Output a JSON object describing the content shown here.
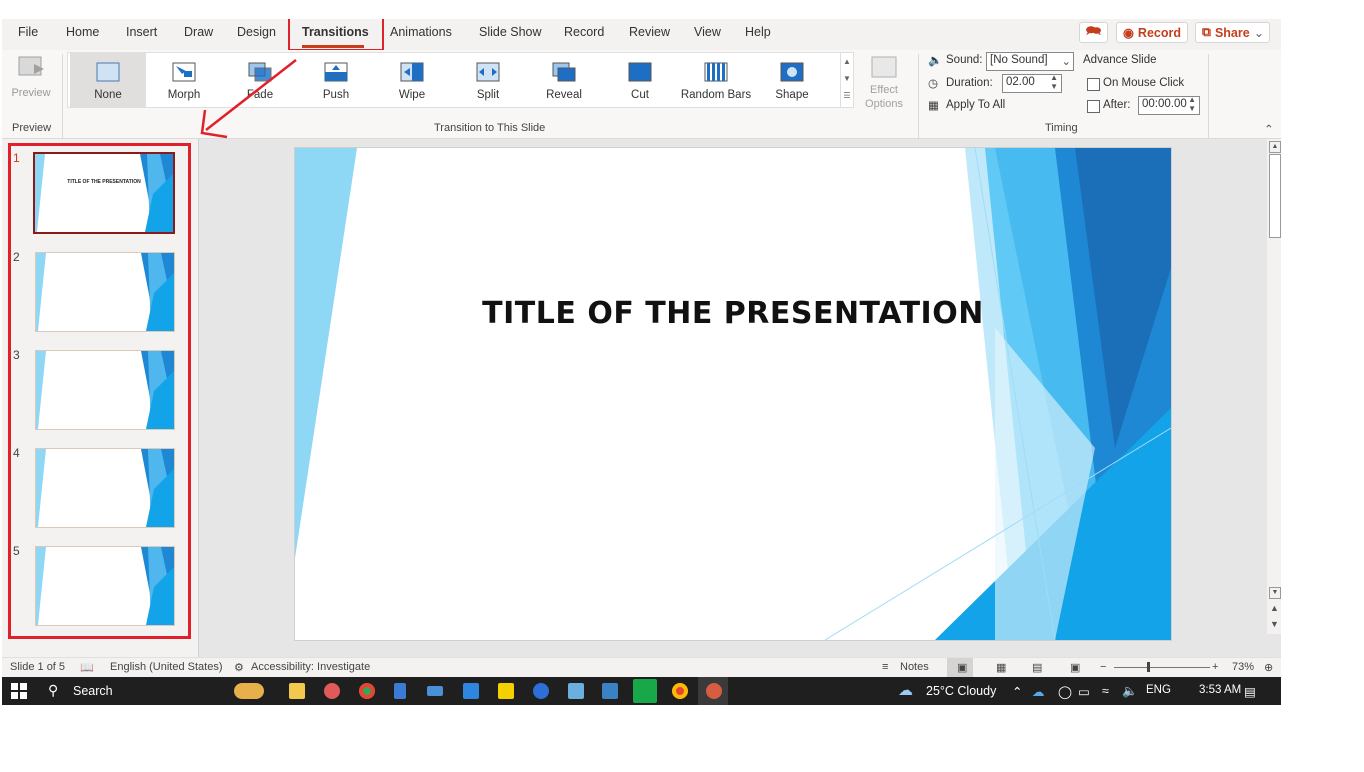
{
  "menu": {
    "tabs": [
      "File",
      "Home",
      "Insert",
      "Draw",
      "Design",
      "Transitions",
      "Animations",
      "Slide Show",
      "Record",
      "Review",
      "View",
      "Help"
    ],
    "active_tab": "Transitions",
    "record_label": "Record",
    "share_label": "Share"
  },
  "ribbon": {
    "preview_label": "Preview",
    "preview_group": "Preview",
    "transitions": [
      "None",
      "Morph",
      "Fade",
      "Push",
      "Wipe",
      "Split",
      "Reveal",
      "Cut",
      "Random Bars",
      "Shape"
    ],
    "selected_transition": "None",
    "effect_options": "Effect Options",
    "transition_group": "Transition to This Slide",
    "sound_label": "Sound:",
    "sound_value": "[No Sound]",
    "duration_label": "Duration:",
    "duration_value": "02.00",
    "apply_all": "Apply To All",
    "advance_slide": "Advance Slide",
    "on_mouse_click": "On Mouse Click",
    "after_label": "After:",
    "after_value": "00:00.00",
    "timing_group": "Timing"
  },
  "thumbnails": [
    {
      "num": "1",
      "title": "TITLE OF THE PRESENTATION"
    },
    {
      "num": "2"
    },
    {
      "num": "3"
    },
    {
      "num": "4"
    },
    {
      "num": "5"
    }
  ],
  "slide": {
    "title": "TITLE OF THE PRESENTATION"
  },
  "status": {
    "slide_count": "Slide 1 of 5",
    "language": "English (United States)",
    "accessibility": "Accessibility: Investigate",
    "notes": "Notes",
    "zoom": "73%"
  },
  "taskbar": {
    "search": "Search",
    "weather": "25°C  Cloudy",
    "lang": "ENG",
    "time": "3:53 AM"
  },
  "colors": {
    "accent": "#c43e1c",
    "highlight_red": "#e0202a",
    "slide_blue": "#1e88d4"
  }
}
